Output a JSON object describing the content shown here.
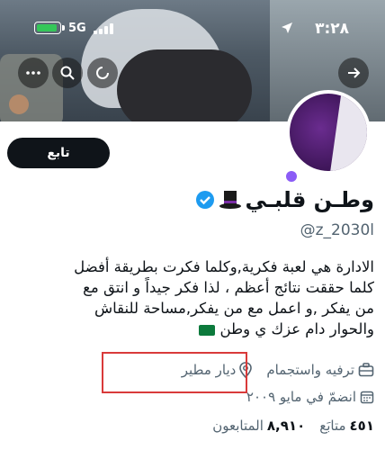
{
  "status_bar": {
    "time": "٣:٢٨",
    "network": "5G"
  },
  "profile": {
    "follow_label": "تابع",
    "display_name": "وطـن قلبـي",
    "handle": "@z_2030l",
    "bio_lines": [
      "الادارة هي لعبة فكرية,وكلما فكرت بطريقة أفضل",
      "كلما حققت نتائج أعظم ، لذا فكر جيداً و انتق مع",
      "من يفكر ,و اعمل مع من يفكر,مساحة للنقاش",
      "والحوار دام عزك ي وطن"
    ],
    "category": "ترفيه واستجمام",
    "location": "ديار مطير",
    "joined": "انضمّ في مايو ٢٠٠٩",
    "following_count": "٤٥١",
    "following_label": "متابَع",
    "followers_count": "٨,٩١٠",
    "followers_label": "المتابعون"
  },
  "icons": {
    "back": "arrow-icon",
    "more": "more-icon",
    "search": "search-icon",
    "refresh": "refresh-icon",
    "verified": "verified-badge-icon",
    "top_hat": "top-hat-emoji",
    "location": "location-pin-icon",
    "category": "briefcase-icon",
    "calendar": "calendar-icon",
    "flag": "saudi-flag-emoji"
  },
  "colors": {
    "accent": "#1d9bf0",
    "highlight_box": "#d93a3a",
    "follow_button_bg": "#0f1419"
  }
}
